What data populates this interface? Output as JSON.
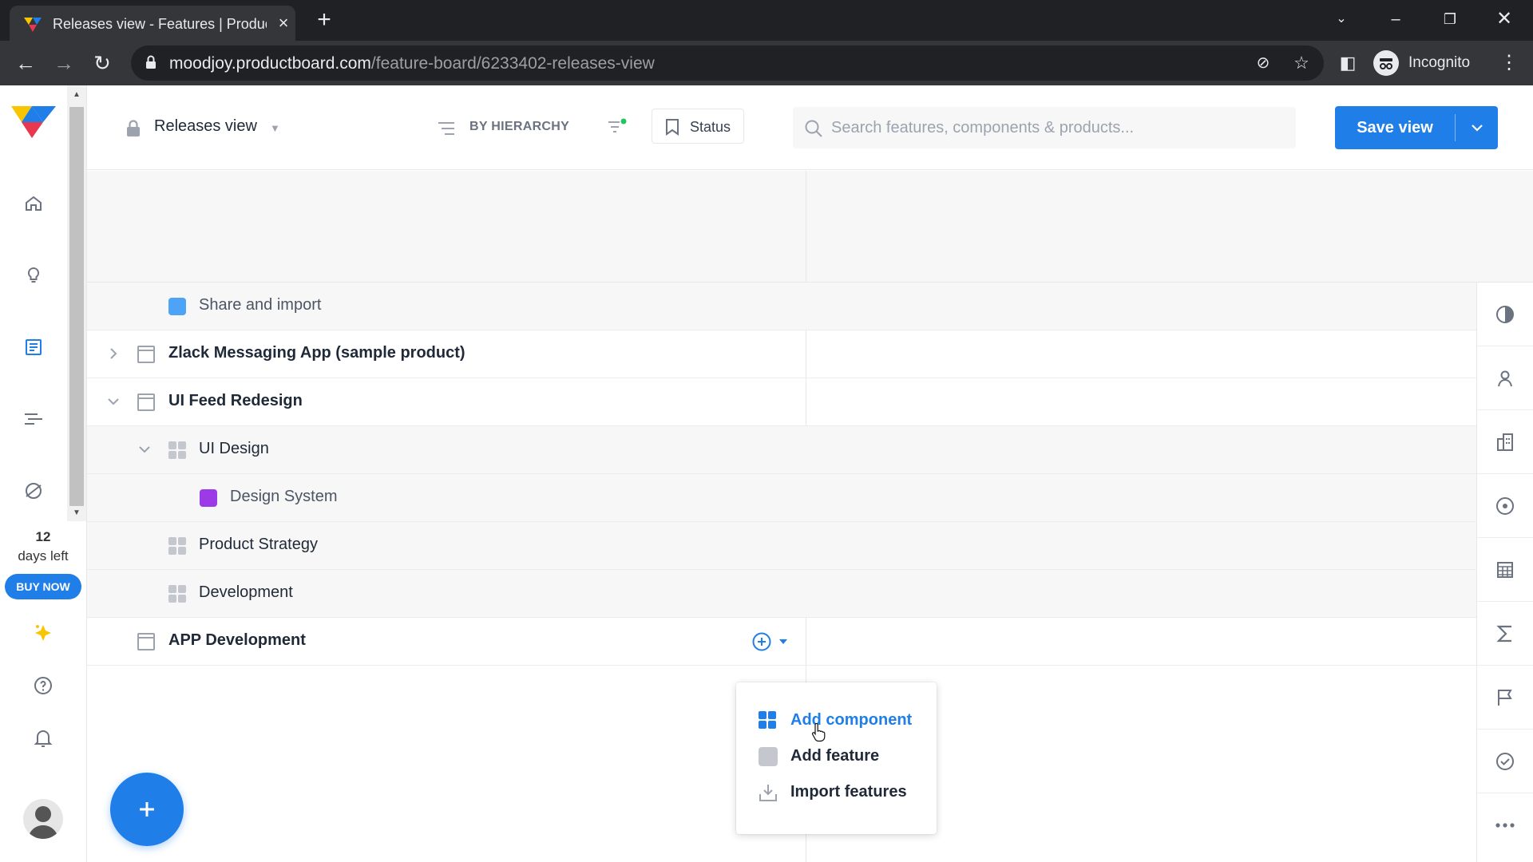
{
  "browser": {
    "tab_title": "Releases view - Features | Produc",
    "url_domain": "moodjoy.productboard.com",
    "url_path": "/feature-board/6233402-releases-view",
    "profile_label": "Incognito"
  },
  "app": {
    "trial": {
      "days": "12",
      "label": "days left",
      "buy_label": "BUY NOW"
    },
    "header": {
      "view_name": "Releases view",
      "grouping_label": "BY HIERARCHY",
      "status_label": "Status",
      "search_placeholder": "Search features, components & products...",
      "save_label": "Save view"
    },
    "rows": [
      {
        "label": "Share and import",
        "kind": "feature",
        "color": "#4da3f5"
      },
      {
        "label": "Zlack Messaging App (sample product)",
        "kind": "product",
        "expanded": false
      },
      {
        "label": "UI Feed Redesign",
        "kind": "product",
        "expanded": true
      },
      {
        "label": "UI Design",
        "kind": "component",
        "expanded": true
      },
      {
        "label": "Design System",
        "kind": "feature",
        "color": "#9b3ae6"
      },
      {
        "label": "Product Strategy",
        "kind": "component"
      },
      {
        "label": "Development",
        "kind": "component"
      },
      {
        "label": "APP Development",
        "kind": "product"
      }
    ],
    "add_menu": {
      "items": [
        {
          "label": "Add component",
          "icon": "component-grid-icon",
          "highlighted": true
        },
        {
          "label": "Add feature",
          "icon": "feature-square-icon"
        },
        {
          "label": "Import features",
          "icon": "import-icon"
        }
      ]
    },
    "colors": {
      "accent": "#1f7ee8",
      "brand_yellow": "#f7c600",
      "brand_red": "#e8384f"
    }
  }
}
